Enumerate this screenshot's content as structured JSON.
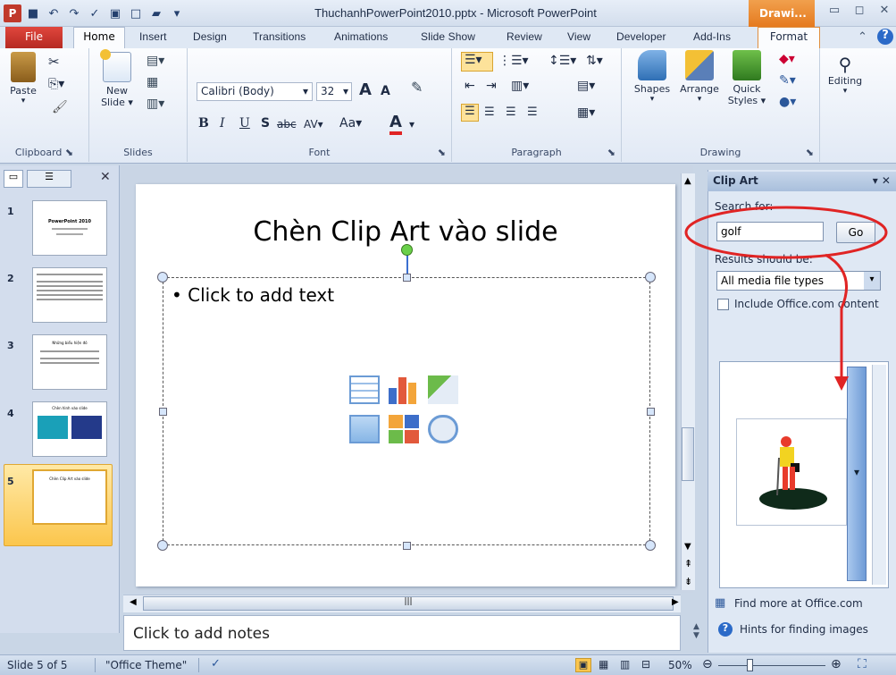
{
  "window": {
    "title": "ThuchanhPowerPoint2010.pptx - Microsoft PowerPoint",
    "context_tab_group": "Drawi...",
    "qat": [
      "app-icon",
      "save-icon",
      "undo-icon",
      "redo-icon",
      "spelling-icon",
      "print-preview-icon",
      "new-icon",
      "open-icon"
    ],
    "controls": {
      "minimize": "▭",
      "restore": "◻",
      "close": "✕"
    }
  },
  "tabs": {
    "file": "File",
    "home": "Home",
    "insert": "Insert",
    "design": "Design",
    "transitions": "Transitions",
    "animations": "Animations",
    "slide_show": "Slide Show",
    "review": "Review",
    "view": "View",
    "developer": "Developer",
    "addins": "Add-Ins",
    "format": "Format"
  },
  "ribbon": {
    "clipboard": {
      "paste": "Paste",
      "label": "Clipboard"
    },
    "slides": {
      "new_slide": "New",
      "new_slide2": "Slide ▾",
      "label": "Slides"
    },
    "font": {
      "name": "Calibri (Body)",
      "size": "32",
      "label": "Font",
      "bold": "B",
      "italic": "I",
      "underline": "U",
      "shadow": "S",
      "strike": "abc",
      "spacing": "AV",
      "case": "Aa",
      "color": "A",
      "grow": "A",
      "shrink": "A"
    },
    "paragraph": {
      "label": "Paragraph"
    },
    "drawing": {
      "shapes": "Shapes",
      "arrange": "Arrange",
      "quick_styles": "Quick",
      "quick_styles2": "Styles ▾",
      "label": "Drawing"
    },
    "editing": {
      "label": "Editing"
    }
  },
  "slides_pane": {
    "thumbs": [
      {
        "num": "1",
        "title": "PowerPoint 2010"
      },
      {
        "num": "2",
        "title": ""
      },
      {
        "num": "3",
        "title": "Những biểu hiện đó"
      },
      {
        "num": "4",
        "title": "Chèn hình vào slide"
      },
      {
        "num": "5",
        "title": "Chèn Clip Art vào slide"
      }
    ]
  },
  "slide": {
    "title": "Chèn Clip Art vào slide",
    "bullet": "Click to add text"
  },
  "notes": {
    "placeholder": "Click to add notes"
  },
  "clip_art": {
    "title": "Clip Art",
    "search_label": "Search for:",
    "search_value": "golf",
    "go": "Go",
    "results_label": "Results should be:",
    "results_value": "All media file types",
    "include_office": "Include Office.com content",
    "find_more": "Find more at Office.com",
    "hints": "Hints for finding images"
  },
  "status": {
    "slide": "Slide 5 of 5",
    "theme": "\"Office Theme\"",
    "zoom": "50%"
  },
  "colors": {
    "annotation": "#e02424",
    "accent": "#2b579a"
  }
}
